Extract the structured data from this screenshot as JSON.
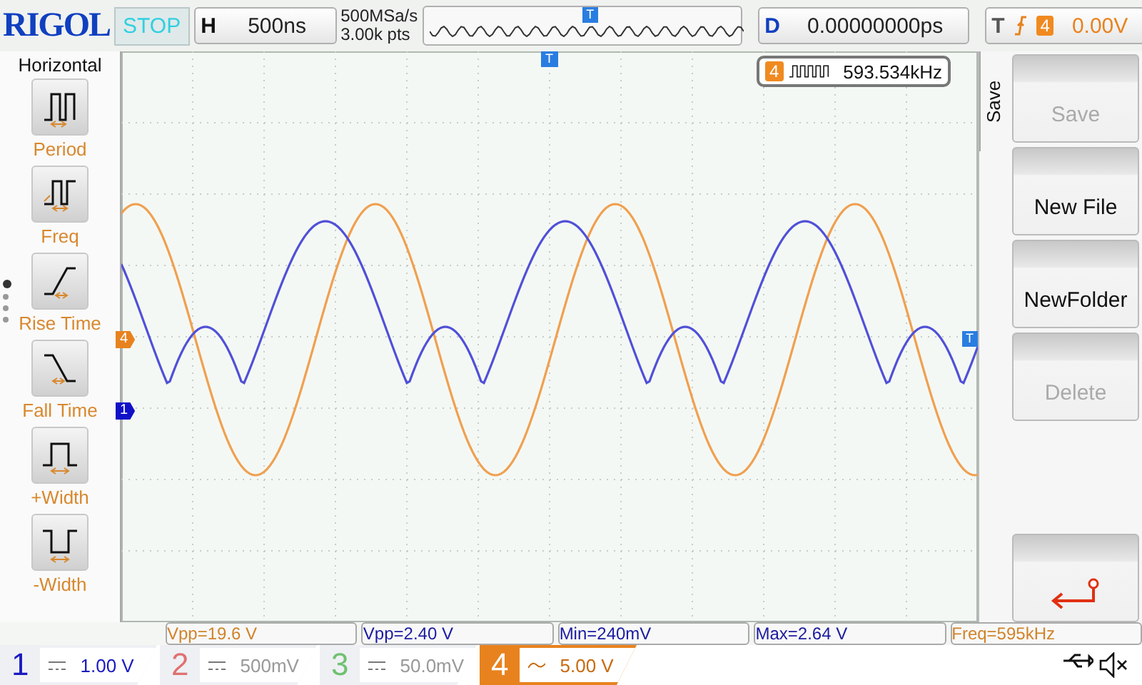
{
  "top_bar": {
    "logo": "RIGOL",
    "run_state": "STOP",
    "horizontal": {
      "label": "H",
      "value": "500ns"
    },
    "sample_rate": "500MSa/s",
    "memory_depth": "3.00k pts",
    "delay": {
      "label": "D",
      "value": "0.00000000ps"
    },
    "trigger": {
      "label": "T",
      "source": "4",
      "level": "0.00V"
    }
  },
  "left_menu": {
    "title": "Horizontal",
    "items": [
      {
        "label": "Period",
        "kind": "period"
      },
      {
        "label": "Freq",
        "kind": "freq"
      },
      {
        "label": "Rise Time",
        "kind": "rise"
      },
      {
        "label": "Fall Time",
        "kind": "fall"
      },
      {
        "label": "+Width",
        "kind": "pwidth"
      },
      {
        "label": "-Width",
        "kind": "nwidth"
      }
    ],
    "pages": [
      {
        "selected": true
      },
      {
        "selected": false
      },
      {
        "selected": false
      },
      {
        "selected": false
      }
    ]
  },
  "plot": {
    "overview_marker": "T",
    "trigger_marker": "T",
    "level_marker": "T",
    "channel_markers": [
      {
        "label": "4",
        "color": "#e8821e"
      },
      {
        "label": "1",
        "color": "#1010c8"
      }
    ],
    "counter": {
      "channel": "4",
      "value": "593.534kHz"
    }
  },
  "right_menu": {
    "tab": "Save",
    "buttons": [
      {
        "kind": "text",
        "label": "Save",
        "disabled": true
      },
      {
        "kind": "text",
        "label": "New File",
        "disabled": false
      },
      {
        "kind": "text",
        "label": "NewFolder",
        "disabled": false
      },
      {
        "kind": "text",
        "label": "Delete",
        "disabled": true
      },
      {
        "kind": "empty"
      },
      {
        "kind": "back",
        "disabled": false
      }
    ]
  },
  "measurements": [
    {
      "text": "Vpp=19.6 V",
      "color": "#d0842a"
    },
    {
      "text": "Vpp=2.40 V",
      "color": "#1a1aa0"
    },
    {
      "text": "Min=240mV",
      "color": "#1a1aa0"
    },
    {
      "text": "Max=2.64 V",
      "color": "#1a1aa0"
    },
    {
      "text": "Freq=595kHz",
      "color": "#d0842a"
    }
  ],
  "channels": [
    {
      "number": "1",
      "kind": "dc",
      "scale": "1.00 V",
      "on": true,
      "selected": false,
      "color": "#1a1ac0"
    },
    {
      "number": "2",
      "kind": "dc",
      "scale": "500mV",
      "on": false,
      "selected": false,
      "color": "#e07070"
    },
    {
      "number": "3",
      "kind": "dc",
      "scale": "50.0mV",
      "on": false,
      "selected": false,
      "color": "#70c070"
    },
    {
      "number": "4",
      "kind": "ac",
      "scale": "5.00 V",
      "on": true,
      "selected": true,
      "color": "#e8821e"
    }
  ]
}
